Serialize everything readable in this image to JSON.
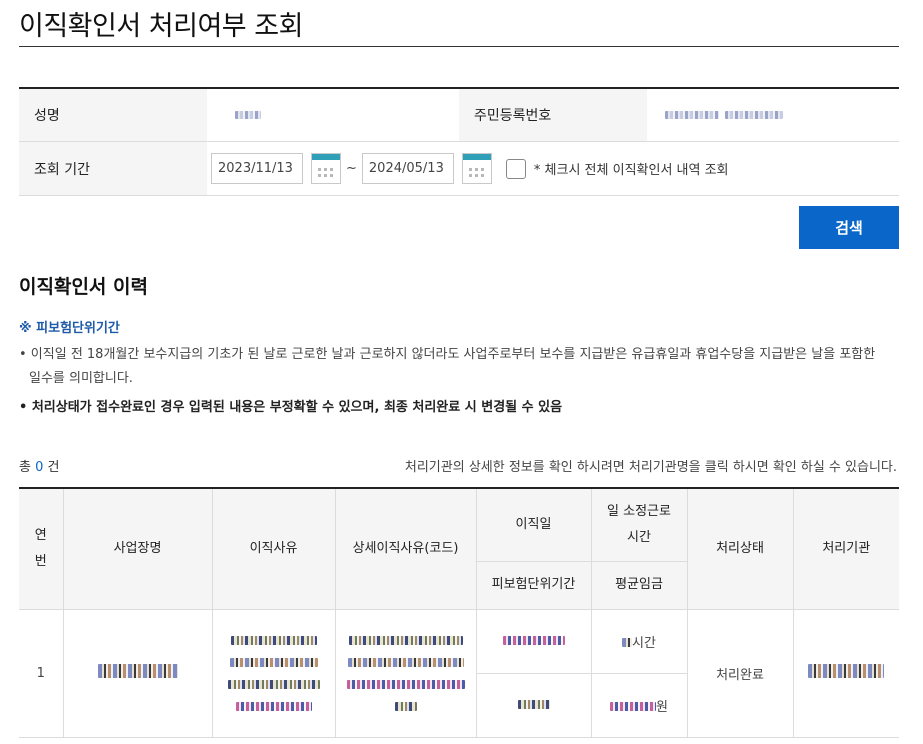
{
  "page": {
    "title": "이직확인서 처리여부 조회"
  },
  "form": {
    "name_label": "성명",
    "rrn_label": "주민등록번호",
    "period_label": "조회 기간",
    "start_date": "2023/11/13",
    "end_date": "2024/05/13",
    "tilde": "~",
    "check_all_label": "* 체크시 전체 이직확인서 내역 조회"
  },
  "search": {
    "button_label": "검색"
  },
  "history": {
    "title": "이직확인서 이력",
    "note_title": "※ 피보험단위기간",
    "note_1": "• 이직일 전 18개월간 보수지급의 기초가 된 날로 근로한 날과 근로하지 않더라도 사업주로부터 보수를 지급받은 유급휴일과 휴업수당을 지급받은 날을 포함한 일수를 의미합니다.",
    "note_2": "• 처리상태가 접수완료인 경우 입력된 내용은 부정확할 수 있으며, 최종 처리완료 시 변경될 수 있음",
    "total_prefix": "총 ",
    "total_count": "0",
    "total_suffix": " 건",
    "help_text": "처리기관의 상세한 정보를 확인 하시려면 처리기관명을 클릭 하시면 확인 하실 수 있습니다."
  },
  "table": {
    "headers": {
      "no": "연\n번",
      "workplace": "사업장명",
      "reason": "이직사유",
      "detail_reason": "상세이직사유(코드)",
      "leave_date": "이직일",
      "insured_period": "피보험단위기간",
      "work_hours": "일 소정근로\n시간",
      "avg_wage": "평균임금",
      "status": "처리상태",
      "agency": "처리기관"
    },
    "rows": [
      {
        "no": "1",
        "hours_suffix": "시간",
        "wage_suffix": "원",
        "status": "처리완료"
      }
    ]
  }
}
